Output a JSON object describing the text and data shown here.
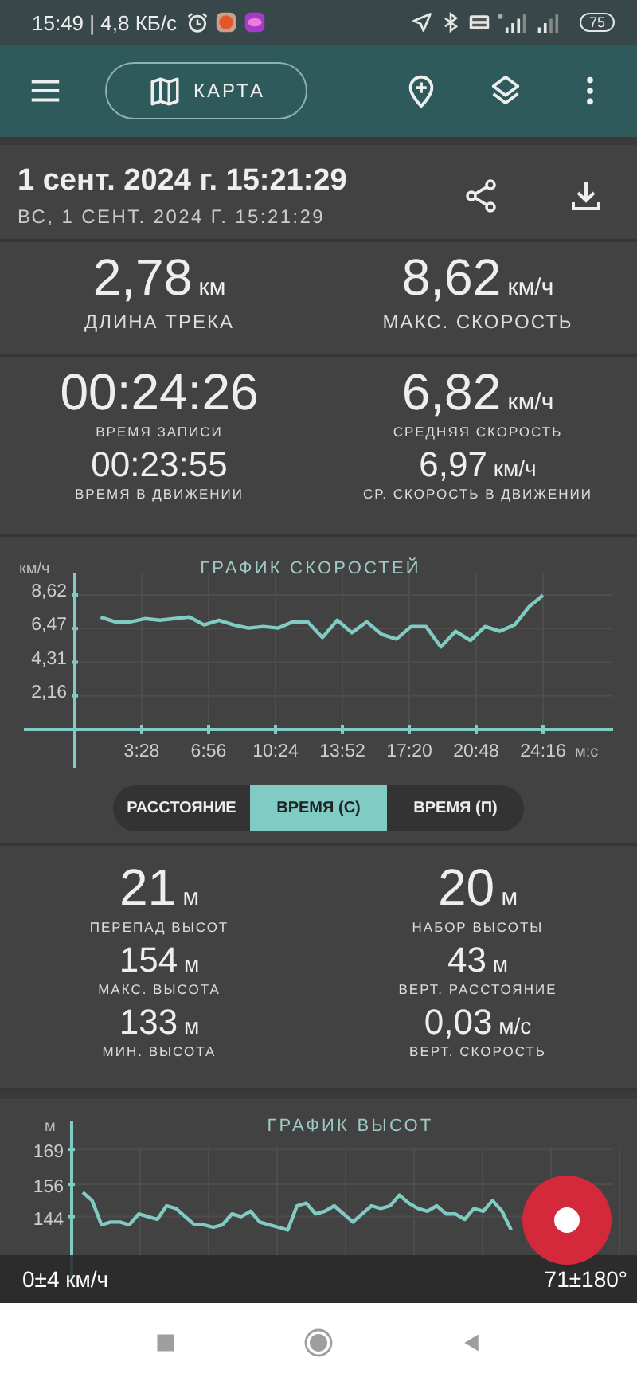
{
  "status_bar": {
    "time": "15:49 | 4,8 КБ/с",
    "battery": "75"
  },
  "toolbar": {
    "map_button": "КАРТА"
  },
  "header": {
    "title": "1 сент. 2024 г. 15:21:29",
    "subtitle": "ВС, 1 СЕНТ. 2024 Г. 15:21:29"
  },
  "track_stats": [
    {
      "rows": [
        [
          {
            "kind": "primary",
            "value": "2,78",
            "unit": "км",
            "label": "ДЛИНА ТРЕКА"
          },
          {
            "kind": "primary",
            "value": "8,62",
            "unit": "км/ч",
            "label": "МАКС. СКОРОСТЬ"
          }
        ]
      ]
    },
    {
      "rows": [
        [
          {
            "kind": "large",
            "value": "00:24:26",
            "label": "ВРЕМЯ ЗАПИСИ"
          },
          {
            "kind": "large",
            "value": "6,82",
            "unit": "км/ч",
            "label": "СРЕДНЯЯ СКОРОСТЬ"
          }
        ],
        [
          {
            "kind": "medium",
            "value": "00:23:55",
            "label": "ВРЕМЯ В ДВИЖЕНИИ"
          },
          {
            "kind": "medium",
            "value": "6,97",
            "unit": "км/ч",
            "label": "СР. СКОРОСТЬ В ДВИЖЕНИИ"
          }
        ]
      ]
    }
  ],
  "speed_chart": {
    "chart_data": {
      "type": "line",
      "title": "ГРАФИК СКОРОСТЕЙ",
      "xlabel": "м:с",
      "ylabel": "км/ч",
      "grid": true,
      "xlim": [
        0,
        1674
      ],
      "ylim": [
        0,
        10
      ],
      "xticks": [
        {
          "value": 208,
          "label": "3:28"
        },
        {
          "value": 416,
          "label": "6:56"
        },
        {
          "value": 624,
          "label": "10:24"
        },
        {
          "value": 832,
          "label": "13:52"
        },
        {
          "value": 1040,
          "label": "17:20"
        },
        {
          "value": 1248,
          "label": "20:48"
        },
        {
          "value": 1456,
          "label": "24:16"
        }
      ],
      "yticks": [
        {
          "value": 2.16,
          "label": "2,16"
        },
        {
          "value": 4.31,
          "label": "4,31"
        },
        {
          "value": 6.47,
          "label": "6,47"
        },
        {
          "value": 8.62,
          "label": "8,62"
        }
      ],
      "x": [
        80,
        126,
        172,
        218,
        264,
        310,
        356,
        402,
        448,
        494,
        540,
        586,
        632,
        678,
        724,
        770,
        816,
        862,
        908,
        954,
        1000,
        1046,
        1092,
        1138,
        1184,
        1230,
        1276,
        1322,
        1368,
        1414,
        1456
      ],
      "series": [
        {
          "color": "#80cbc4",
          "values": [
            7.2,
            6.9,
            6.9,
            7.1,
            7.0,
            7.1,
            7.2,
            6.7,
            7.0,
            6.7,
            6.5,
            6.6,
            6.5,
            6.9,
            6.9,
            5.9,
            7.0,
            6.2,
            6.9,
            6.1,
            5.8,
            6.6,
            6.6,
            5.3,
            6.3,
            5.7,
            6.6,
            6.3,
            6.7,
            7.9,
            8.6
          ]
        }
      ]
    }
  },
  "view_tabs": [
    {
      "label": "РАССТОЯНИЕ",
      "selected": false
    },
    {
      "label": "ВРЕМЯ (С)",
      "selected": true
    },
    {
      "label": "ВРЕМЯ (П)",
      "selected": false
    }
  ],
  "altitude_stats": [
    {
      "rows": [
        [
          {
            "kind": "large",
            "value": "21",
            "unit": "м",
            "label": "ПЕРЕПАД ВЫСОТ"
          },
          {
            "kind": "large",
            "value": "20",
            "unit": "м",
            "label": "НАБОР ВЫСОТЫ"
          }
        ],
        [
          {
            "kind": "medium",
            "value": "154",
            "unit": "м",
            "label": "МАКС. ВЫСОТА"
          },
          {
            "kind": "medium",
            "value": "43",
            "unit": "м",
            "label": "ВЕРТ. РАССТОЯНИЕ"
          }
        ],
        [
          {
            "kind": "medium",
            "value": "133",
            "unit": "м",
            "label": "МИН. ВЫСОТА"
          },
          {
            "kind": "medium",
            "value": "0,03",
            "unit": "м/с",
            "label": "ВЕРТ. СКОРОСТЬ"
          }
        ]
      ]
    }
  ],
  "altitude_chart": {
    "chart_data": {
      "type": "line",
      "title": "ГРАФИК ВЫСОТ",
      "ylabel": "м",
      "grid": true,
      "ylim": [
        119,
        180
      ],
      "yticks": [
        {
          "value": 144,
          "label": "144"
        },
        {
          "value": 156,
          "label": "156"
        },
        {
          "value": 169,
          "label": "169"
        }
      ],
      "series": [
        {
          "color": "#80cbc4",
          "values": [
            153,
            150,
            141,
            142,
            142,
            141,
            145,
            144,
            143,
            148,
            147,
            144,
            141,
            141,
            140,
            141,
            145,
            144,
            146,
            142,
            141,
            140,
            139,
            148,
            149,
            145,
            146,
            148,
            145,
            142,
            145,
            148,
            147,
            148,
            152,
            149,
            147,
            146,
            148,
            145,
            145,
            143,
            147,
            146,
            150,
            146,
            139
          ]
        }
      ]
    }
  },
  "gps_bar": {
    "speed": "0±4 км/ч",
    "bearing": "71±180°"
  }
}
